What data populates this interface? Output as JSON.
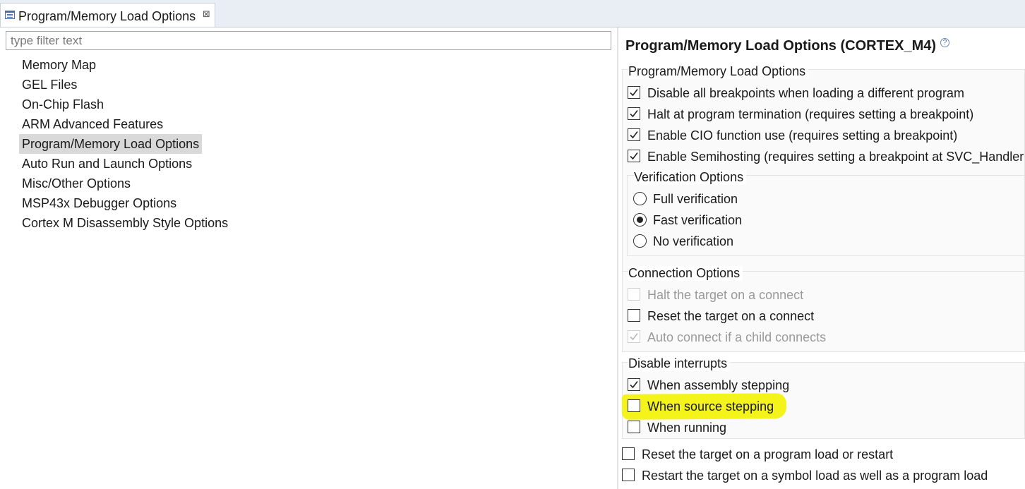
{
  "tab": {
    "label": "Program/Memory Load Options",
    "icon": "properties-page-icon",
    "close_glyph": "⊠"
  },
  "filter": {
    "placeholder": "type filter text",
    "value": ""
  },
  "tree": {
    "items": [
      {
        "label": "Memory Map"
      },
      {
        "label": "GEL Files"
      },
      {
        "label": "On-Chip Flash"
      },
      {
        "label": "ARM Advanced Features"
      },
      {
        "label": "Program/Memory Load Options",
        "selected": true
      },
      {
        "label": "Auto Run and Launch Options"
      },
      {
        "label": "Misc/Other Options"
      },
      {
        "label": "MSP43x Debugger Options"
      },
      {
        "label": "Cortex M Disassembly Style Options"
      }
    ]
  },
  "panel": {
    "title": "Program/Memory Load Options (CORTEX_M4)",
    "help_glyph": "?",
    "load_group": {
      "title": "Program/Memory Load Options",
      "options": [
        {
          "label": "Disable all breakpoints when loading a different program",
          "checked": true
        },
        {
          "label": "Halt at program termination (requires setting a breakpoint)",
          "checked": true
        },
        {
          "label": "Enable CIO function use (requires setting a breakpoint)",
          "checked": true
        },
        {
          "label": "Enable Semihosting (requires setting a breakpoint at SVC_Handler )",
          "checked": true
        }
      ]
    },
    "verification_group": {
      "title": "Verification Options",
      "options": [
        {
          "label": "Full verification",
          "selected": false
        },
        {
          "label": "Fast verification",
          "selected": true
        },
        {
          "label": "No verification",
          "selected": false
        }
      ]
    },
    "connection_group": {
      "title": "Connection Options",
      "options": [
        {
          "label": "Halt the target on a connect",
          "checked": false,
          "disabled": true
        },
        {
          "label": "Reset the target on a connect",
          "checked": false,
          "disabled": false
        },
        {
          "label": "Auto connect if a child connects",
          "checked": true,
          "disabled": true
        }
      ]
    },
    "interrupts_group": {
      "title": "Disable interrupts",
      "options": [
        {
          "label": "When assembly stepping",
          "checked": true
        },
        {
          "label": "When source stepping",
          "checked": false,
          "highlighted": true
        },
        {
          "label": "When running",
          "checked": false
        }
      ]
    },
    "bottom_options": [
      {
        "label": "Reset the target on a program load or restart",
        "checked": false
      },
      {
        "label": "Restart the target on a symbol load as well as a program load",
        "checked": false
      }
    ]
  },
  "colors": {
    "tabbar_bg": "#e9edf4",
    "selection_bg": "#d9d9d9",
    "highlight": "#f4f31a",
    "disabled_text": "#9a9a9a"
  }
}
